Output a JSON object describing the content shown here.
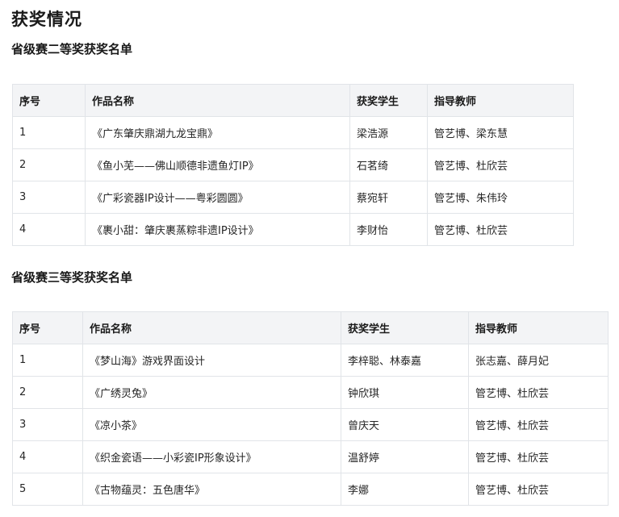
{
  "page": {
    "title": "获奖情况"
  },
  "sections": [
    {
      "title": "省级赛二等奖获奖名单",
      "headers": [
        "序号",
        "作品名称",
        "获奖学生",
        "指导教师"
      ],
      "rows": [
        [
          "1",
          "《广东肇庆鼎湖九龙宝鼎》",
          "梁浩源",
          "管艺博、梁东慧"
        ],
        [
          "2",
          "《鱼小芜——佛山顺德非遗鱼灯IP》",
          "石茗绮",
          "管艺博、杜欣芸"
        ],
        [
          "3",
          "《广彩瓷器IP设计——粤彩圆圆》",
          "蔡宛轩",
          "管艺博、朱伟玲"
        ],
        [
          "4",
          "《裹小甜：肇庆裹蒸粽非遗IP设计》",
          "李财怡",
          "管艺博、杜欣芸"
        ]
      ]
    },
    {
      "title": "省级赛三等奖获奖名单",
      "headers": [
        "序号",
        "作品名称",
        "获奖学生",
        "指导教师"
      ],
      "rows": [
        [
          "1",
          "《梦山海》游戏界面设计",
          "李梓聪、林泰嘉",
          "张志嘉、薛月妃"
        ],
        [
          "2",
          "《广绣灵兔》",
          "钟欣琪",
          "管艺博、杜欣芸"
        ],
        [
          "3",
          "《凉小茶》",
          "曾庆天",
          "管艺博、杜欣芸"
        ],
        [
          "4",
          "《织金瓷语——小彩瓷IP形象设计》",
          "温舒婷",
          "管艺博、杜欣芸"
        ],
        [
          "5",
          "《古物蕴灵：五色唐华》",
          "李娜",
          "管艺博、杜欣芸"
        ]
      ]
    }
  ]
}
